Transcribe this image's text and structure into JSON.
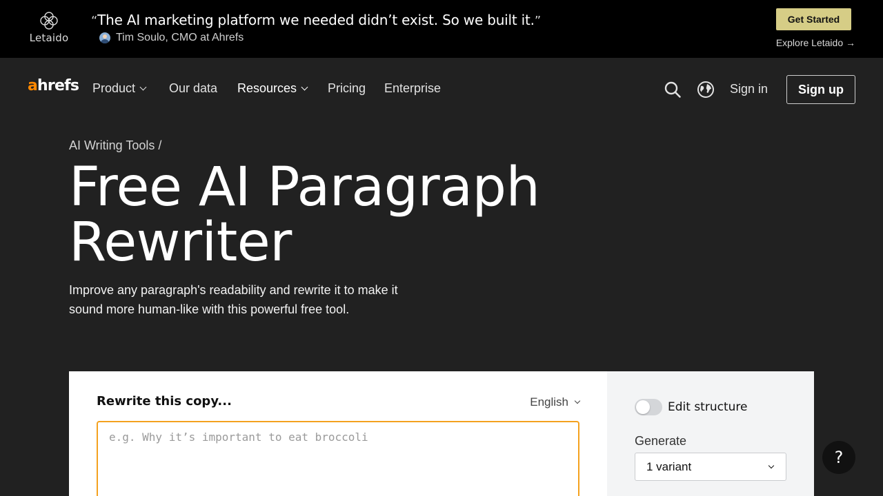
{
  "promo": {
    "brand": "Letaido",
    "quote": "The AI marketing platform we needed didn’t exist. So we built it.",
    "open_quote": "“",
    "close_quote": "”",
    "author": "Tim Soulo, CMO at Ahrefs",
    "cta_label": "Get Started",
    "explore_label": "Explore Letaido →",
    "cta_color": "#d6cd86"
  },
  "nav": {
    "logo_a": "a",
    "logo_rest": "hrefs",
    "items": [
      {
        "label": "Product",
        "dropdown": true
      },
      {
        "label": "Our data",
        "dropdown": false
      },
      {
        "label": "Resources",
        "dropdown": true
      },
      {
        "label": "Pricing",
        "dropdown": false
      },
      {
        "label": "Enterprise",
        "dropdown": false
      }
    ],
    "search_icon": "search-icon",
    "language_icon": "globe-icon",
    "signin_label": "Sign in",
    "signup_label": "Sign up",
    "brand_color": "#ff8800"
  },
  "hero": {
    "breadcrumb": "AI Writing Tools /",
    "title_line1": "Free AI Paragraph",
    "title_line2": "Rewriter",
    "subtitle": "Improve any paragraph's readability and rewrite it to make it sound more human-like with this powerful free tool."
  },
  "tool": {
    "label": "Rewrite this copy...",
    "language": "English",
    "input_value": "",
    "input_placeholder": "e.g. Why it’s important to eat broccoli",
    "input_border_color": "#f4a11e",
    "edit_structure_label": "Edit structure",
    "edit_structure_on": false,
    "generate_label": "Generate",
    "generate_value": "1 variant"
  },
  "help": {
    "label": "?"
  }
}
